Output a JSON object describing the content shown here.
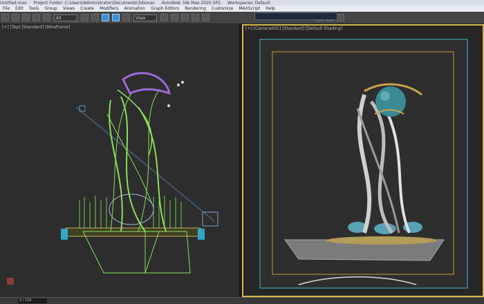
{
  "titlebar": {
    "file": "Untitled.max",
    "project": "Project Folder: C:\\Users\\Administrator\\Documents\\3dsmax",
    "app": "Autodesk 3ds Max 2020 SP2",
    "workspace": "Workspaces: Default"
  },
  "menubar": [
    "File",
    "Edit",
    "Tools",
    "Group",
    "Views",
    "Create",
    "Modifiers",
    "Animation",
    "Graph Editors",
    "Rendering",
    "Customize",
    "MAXScript",
    "Help"
  ],
  "toolbar": {
    "selection_filter": "All",
    "view_dropdown": "View",
    "workspace_field": ""
  },
  "viewports": {
    "left_label": "[+] [Top] [Standard] [Wireframe]",
    "right_label": "[+] [Camera001] [Standard] [Default Shading]"
  },
  "status": {
    "coord": "0 / 100"
  },
  "colors": {
    "wireframe": "#8be05a",
    "wireframe_top": "#9a6ad9",
    "sphere": "#3a8a94",
    "frame_outer": "#49b6c9",
    "frame_inner": "#c79a38",
    "safe_frame": "#d9b84a"
  },
  "icons": [
    "undo-icon",
    "redo-icon",
    "link-icon",
    "unlink-icon",
    "bind-icon",
    "select-icon",
    "select-region-icon",
    "move-icon",
    "rotate-icon",
    "scale-icon",
    "snap-icon",
    "angle-snap-icon",
    "mirror-icon",
    "align-icon",
    "layer-icon",
    "render-setup-icon",
    "render-frame-icon",
    "render-icon"
  ]
}
